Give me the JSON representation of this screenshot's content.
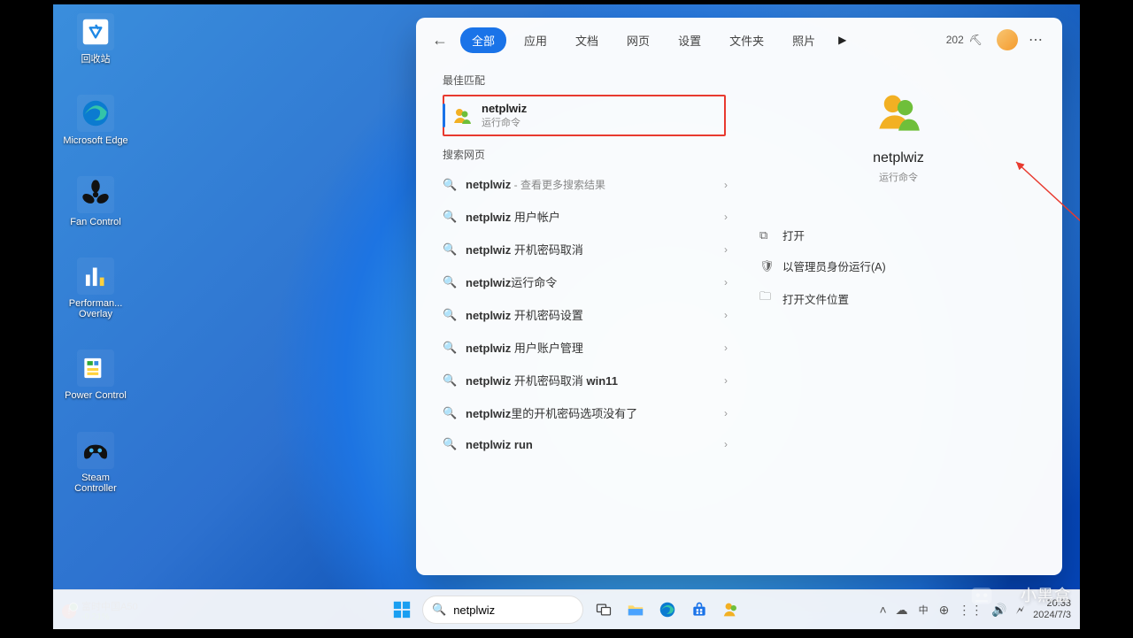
{
  "desktop_icons": [
    {
      "id": "recycle",
      "label": "回收站"
    },
    {
      "id": "edge",
      "label": "Microsoft Edge"
    },
    {
      "id": "fan",
      "label": "Fan Control"
    },
    {
      "id": "perf",
      "label": "Performan... Overlay"
    },
    {
      "id": "power",
      "label": "Power Control"
    },
    {
      "id": "steam",
      "label": "Steam Controller"
    }
  ],
  "search_panel": {
    "tabs": [
      "全部",
      "应用",
      "文档",
      "网页",
      "设置",
      "文件夹",
      "照片"
    ],
    "active_tab": 0,
    "points": "202",
    "sections": {
      "best": "最佳匹配",
      "web": "搜索网页"
    },
    "best_match": {
      "title": "netplwiz",
      "subtitle": "运行命令"
    },
    "web_results": [
      {
        "text": "netplwiz",
        "extra": "- 查看更多搜索结果"
      },
      {
        "text": "netplwiz 用户帐户"
      },
      {
        "text": "netplwiz 开机密码取消"
      },
      {
        "text": "netplwiz运行命令"
      },
      {
        "text": "netplwiz 开机密码设置"
      },
      {
        "text": "netplwiz 用户账户管理"
      },
      {
        "text": "netplwiz 开机密码取消 win11"
      },
      {
        "text": "netplwiz里的开机密码选项没有了"
      },
      {
        "text": "netplwiz run"
      }
    ],
    "detail": {
      "name": "netplwiz",
      "type": "运行命令",
      "actions": [
        "打开",
        "以管理员身份运行(A)",
        "打开文件位置"
      ]
    }
  },
  "taskbar": {
    "search_placeholder": "",
    "search_value": "netplwiz",
    "stock": {
      "name": "富时中国A50",
      "change": "-0.21%"
    },
    "tray": {
      "ime": "中",
      "time": "20:33",
      "date": "2024/7/3"
    }
  },
  "watermark": "小黑盒"
}
